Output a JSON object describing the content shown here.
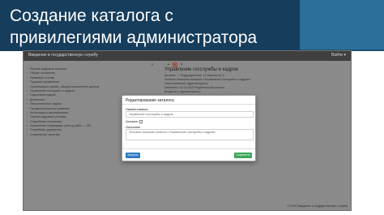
{
  "slide": {
    "title_line1": "Создание каталога с",
    "title_line2": "привилегиями администратора"
  },
  "app": {
    "brand": "Введение в государственную службу",
    "user": "Войти ▾",
    "footer": "© 2020 Введение в государственную службу"
  },
  "sidebar": {
    "items": [
      "Личные кадровые вопросы",
      "Общие положения",
      "Правовые основы",
      "Трудовое управление",
      "Организация службы, общеустановленные данные",
      "Управление госслужбы и кадров",
      "Подготовка кадров",
      "Должности",
      "Испытательные задачи",
      "Профессиональное развитие",
      "Аттестация и квалификация",
      "Оценка кадрового резерва",
      "Служебные отношения",
      "Управление служащими, реестр работ — ФЗ",
      "Служебные документы",
      "Социальные гарантии"
    ]
  },
  "panel": {
    "title": "Управление госслужбы и кадров",
    "lines": [
      "Активно: ✓  Подразделение: 12  Каталогов: 5",
      "Учебное описание каталога «Управление госслужбы и кадров»",
      "Ответственный: Администратор",
      "Изменено: 01.02.2020  Родительский каталог",
      "Владелец: Администратор"
    ]
  },
  "modal": {
    "title": "Редактирование каталога",
    "name_label": "Наименование",
    "name_value": "Управление госслужбы и кадров",
    "active_label": "Активен",
    "description_label": "Описание",
    "description_value": "Тестовое описание каталога «Управление госслужбы и кадров»",
    "close_button": "Закрыть",
    "save_button": "Сохранить"
  }
}
